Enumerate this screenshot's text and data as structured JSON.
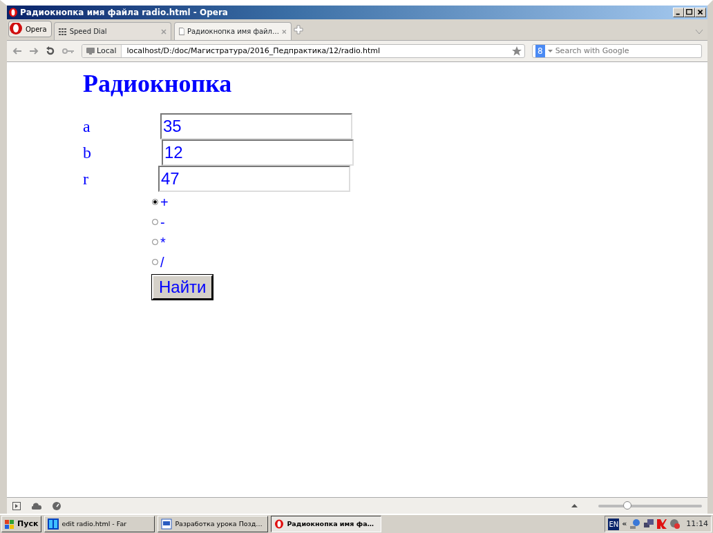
{
  "window": {
    "title": "Радиокнопка имя файла radio.html - Opera"
  },
  "opera_menu": {
    "label": "Opera"
  },
  "tabs": [
    {
      "label": "Speed Dial",
      "selected": false
    },
    {
      "label": "Радиокнопка имя файл…",
      "selected": true
    }
  ],
  "address_bar": {
    "badge": "Local",
    "url": "localhost/D:/doc/Магистратура/2016_Педпрактика/12/radio.html"
  },
  "search": {
    "engine": "8",
    "placeholder": "Search with Google"
  },
  "page": {
    "heading": "Радиокнопка",
    "fields": [
      {
        "label": "a",
        "value": "35"
      },
      {
        "label": "b",
        "value": "12"
      },
      {
        "label": "r",
        "value": "47"
      }
    ],
    "radios": [
      {
        "label": "+",
        "selected": true
      },
      {
        "label": "-",
        "selected": false
      },
      {
        "label": "*",
        "selected": false
      },
      {
        "label": "/",
        "selected": false
      }
    ],
    "button": "Найти"
  },
  "status_bar": {
    "zoom": {
      "level": 0.28
    }
  },
  "taskbar": {
    "start": "Пуск",
    "tasks": [
      {
        "label": "edit radio.html - Far",
        "selected": false
      },
      {
        "label": "Разработка урока Позд…",
        "selected": false
      },
      {
        "label": "Радиокнопка имя фа…",
        "selected": true
      }
    ],
    "language": "EN",
    "chevron": "«",
    "clock": "11:14"
  }
}
